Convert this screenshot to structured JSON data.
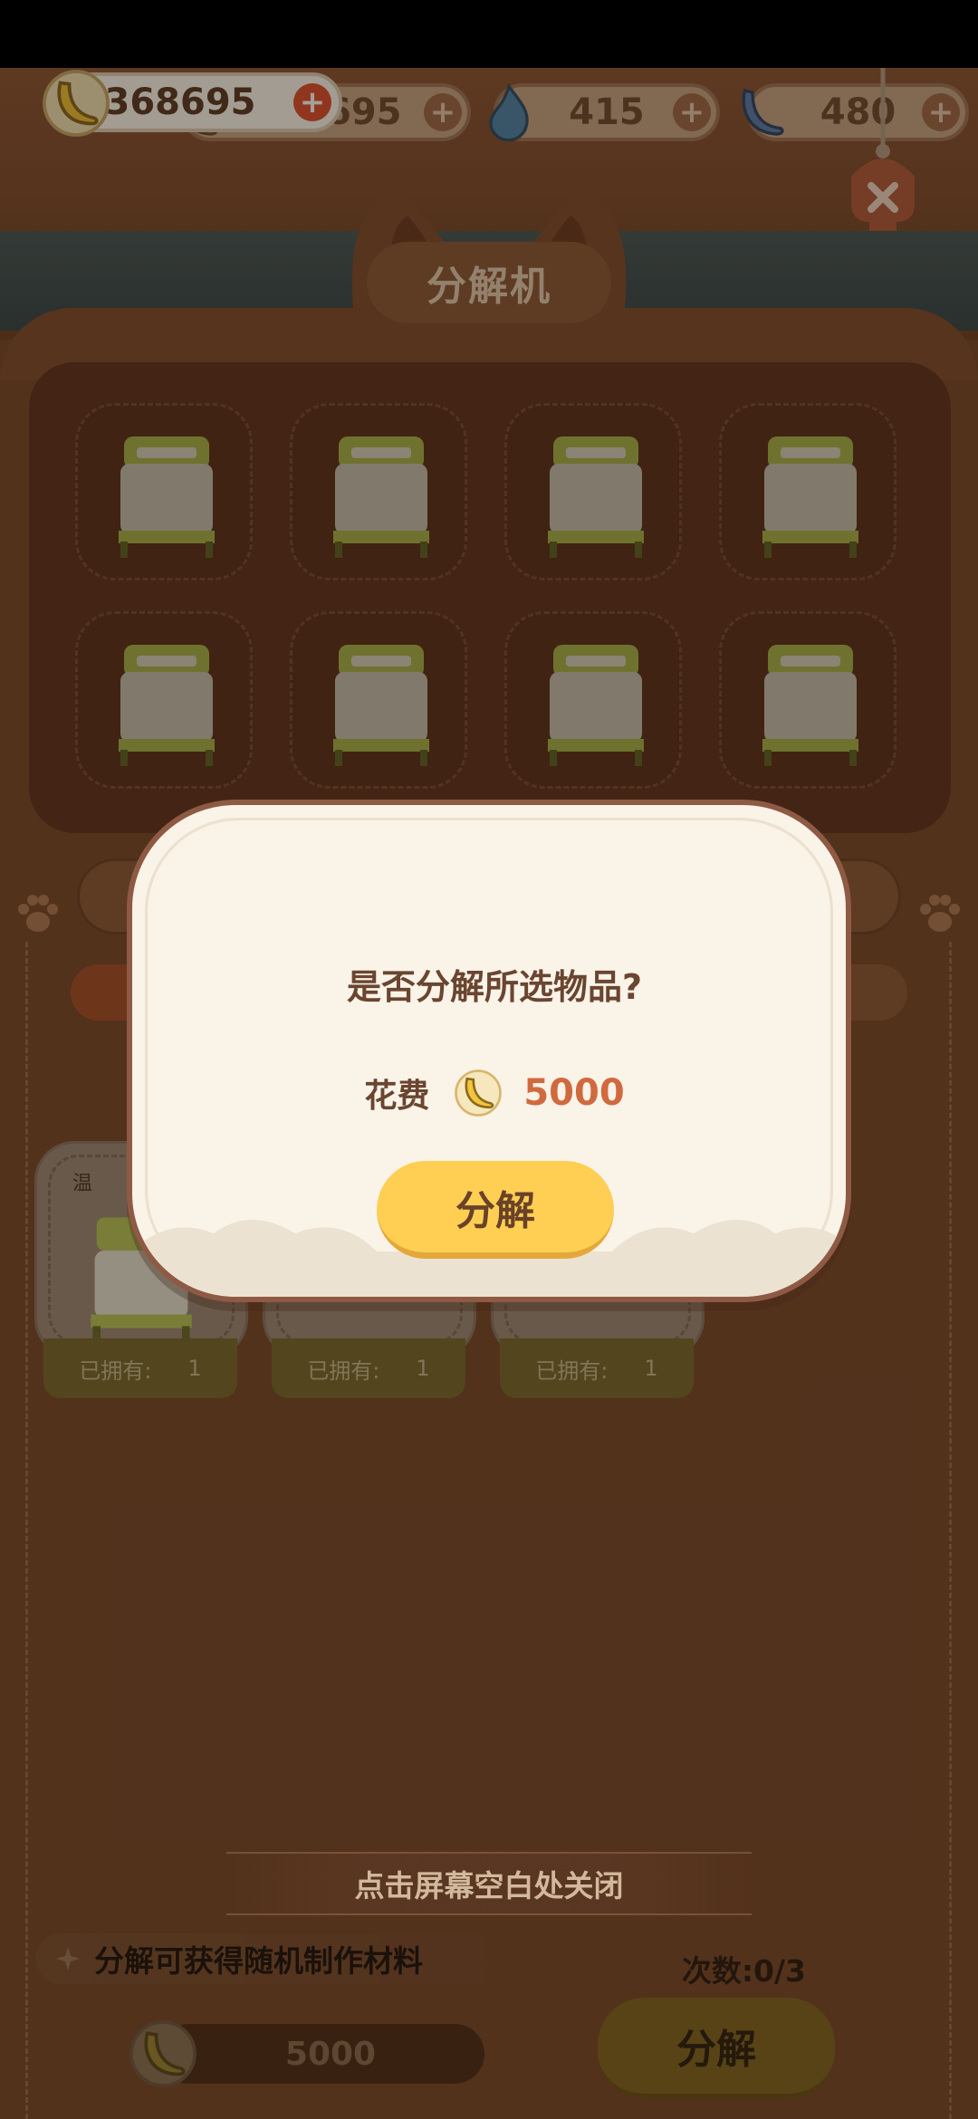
{
  "header": {
    "currencies_back": [
      {
        "icon": "banana-icon",
        "value": "368695"
      },
      {
        "icon": "blue-flame-icon",
        "value": "415"
      },
      {
        "icon": "blue-banana-icon",
        "value": "480"
      }
    ],
    "banana_balance": "368695",
    "plus_symbol": "+"
  },
  "machine": {
    "title": "分解机",
    "slots": [
      {
        "icon": "bed-icon"
      },
      {
        "icon": "bed-icon"
      },
      {
        "icon": "bed-icon"
      },
      {
        "icon": "bed-icon"
      },
      {
        "icon": "bed-icon"
      },
      {
        "icon": "bed-icon"
      },
      {
        "icon": "bed-icon"
      },
      {
        "icon": "bed-icon"
      }
    ]
  },
  "inventory": {
    "first_card_category": "温",
    "owned_label": "已拥有:",
    "cards": [
      {
        "owned": "1"
      },
      {
        "owned": "1"
      },
      {
        "owned": "1"
      }
    ]
  },
  "footer": {
    "close_hint": "点击屏幕空白处关闭",
    "info": "分解可获得随机制作材料",
    "times": "次数:0/3",
    "cost": "5000",
    "button": "分解"
  },
  "dialog": {
    "question": "是否分解所选物品?",
    "cost_label": "花费",
    "cost_value": "5000",
    "confirm": "分解"
  },
  "colors": {
    "accent_orange": "#d06a3e",
    "button_yellow": "#ffcf53",
    "panel_brown": "#7a4a2c"
  }
}
